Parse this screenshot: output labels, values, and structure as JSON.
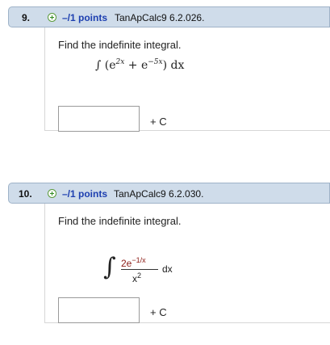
{
  "questions": [
    {
      "number": "9.",
      "points": "–/1 points",
      "code": "TanApCalc9 6.2.026.",
      "prompt": "Find the indefinite integral.",
      "formula": {
        "integral": "∫",
        "open": "(e",
        "exp1": "2x",
        "middle": " + e",
        "exp2": "−5x",
        "close": ") dx"
      },
      "answer_value": "",
      "suffix": "+ C"
    },
    {
      "number": "10.",
      "points": "–/1 points",
      "code": "TanApCalc9 6.2.030.",
      "prompt": "Find the indefinite integral.",
      "formula": {
        "integral": "∫",
        "numerator_base": "2e",
        "numerator_exp": "−1/x",
        "denominator_base": "x",
        "denominator_exp": "2",
        "differential": "dx"
      },
      "answer_value": "",
      "suffix": "+ C"
    }
  ],
  "icons": {
    "expand": "plus-circle-icon"
  },
  "colors": {
    "header_bg": "#cfdcea",
    "points_text": "#1d3fb0",
    "expand_icon": "#2f8a1e",
    "numerator_text": "#8b1a14"
  }
}
